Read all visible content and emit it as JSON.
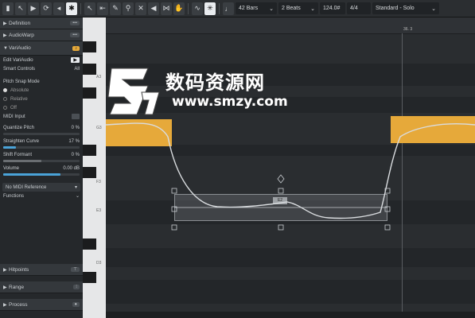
{
  "toolbar": {
    "bars": "42 Bars",
    "beats": "2 Beats",
    "tempo": "124.0#",
    "signature": "4/4",
    "preset": "Standard - Solo"
  },
  "sidebar": {
    "sections": {
      "definition": "Definition",
      "audiowarp": "AudioWarp",
      "variaudio": "VariAudio",
      "hitpoints": "Hitpoints",
      "range": "Range",
      "process": "Process"
    },
    "edit_variaudio": "Edit VariAudio",
    "smart_controls": "Smart Controls",
    "smart_controls_value": "All",
    "pitch_snap_mode": "Pitch Snap Mode",
    "snap_options": [
      "Absolute",
      "Relative",
      "Off"
    ],
    "midi_input": "MIDI Input",
    "quantize_pitch": {
      "label": "Quantize Pitch",
      "value": "0 %",
      "level": 0
    },
    "straighten_curve": {
      "label": "Straighten Curve",
      "value": "17 %",
      "level": 0.17
    },
    "shift_formant": {
      "label": "Shift Formant",
      "value": "0 %",
      "level": 0.5
    },
    "volume": {
      "label": "Volume",
      "value": "0.00 dB",
      "level": 0.75
    },
    "midi_reference": "No MIDI Reference",
    "functions": "Functions"
  },
  "piano_labels": [
    "A3",
    "G3",
    "F3",
    "E3",
    "D3"
  ],
  "ruler_marker": "36. 3",
  "segment_label": "E2",
  "watermark": {
    "main": "数码资源网",
    "sub": "www.smzy.com"
  },
  "colors": {
    "accent_orange": "#e6a93a",
    "slider_blue": "#4aa3d8",
    "background": "#2a2d30"
  },
  "icons": [
    "pointer-icon",
    "play-icon",
    "loop-icon",
    "pencil-icon",
    "zoom-icon",
    "speaker-icon",
    "metronome-icon",
    "note-icon"
  ]
}
